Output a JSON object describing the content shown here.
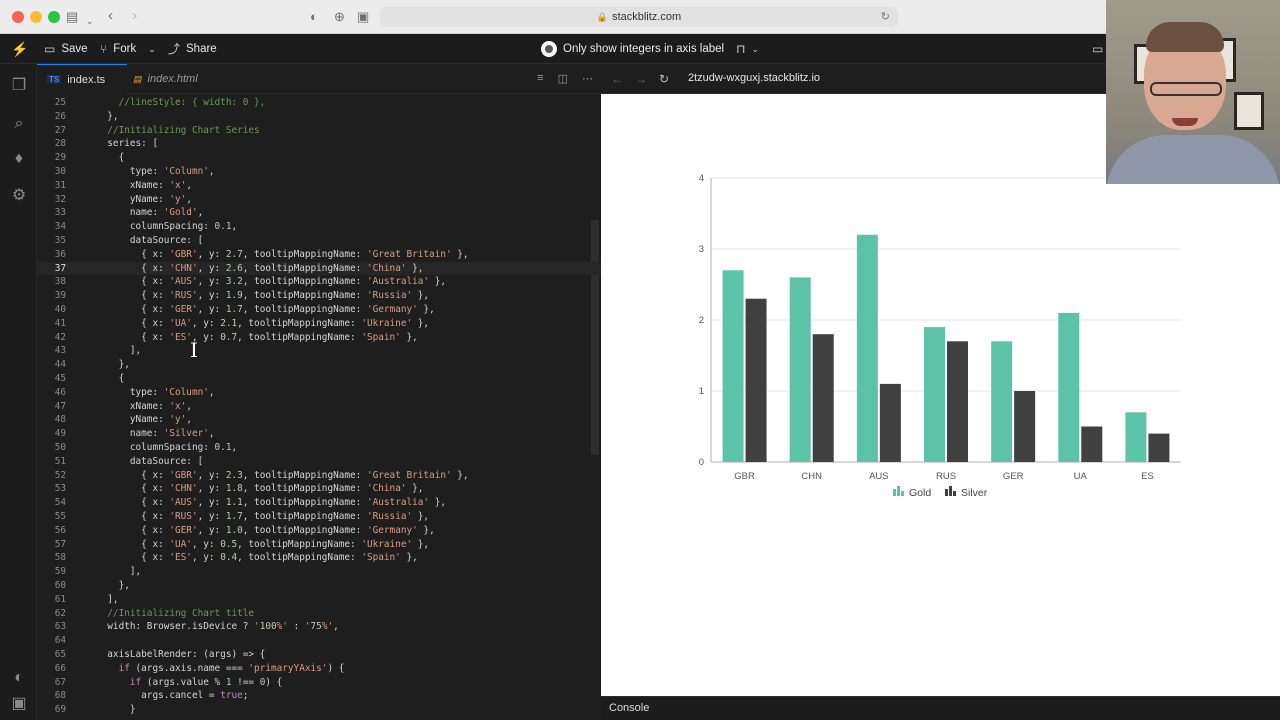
{
  "browser": {
    "url": "stackblitz.com"
  },
  "stackblitz": {
    "save_label": "Save",
    "fork_label": "Fork",
    "share_label": "Share",
    "project_title": "Only show integers in axis label"
  },
  "tabs": [
    {
      "label": "index.ts",
      "badge": "TS"
    },
    {
      "label": "index.html"
    }
  ],
  "preview": {
    "url": "2tzudw-wxguxj.stackblitz.io"
  },
  "console_label": "Console",
  "code_lines": [
    {
      "n": "25",
      "t": "    //lineStyle: { width: 0 },"
    },
    {
      "n": "26",
      "t": "  },"
    },
    {
      "n": "27",
      "t": "  //Initializing Chart Series"
    },
    {
      "n": "28",
      "t": "  series: ["
    },
    {
      "n": "29",
      "t": "    {"
    },
    {
      "n": "30",
      "t": "      type: 'Column',"
    },
    {
      "n": "31",
      "t": "      xName: 'x',"
    },
    {
      "n": "32",
      "t": "      yName: 'y',"
    },
    {
      "n": "33",
      "t": "      name: 'Gold',"
    },
    {
      "n": "34",
      "t": "      columnSpacing: 0.1,"
    },
    {
      "n": "35",
      "t": "      dataSource: ["
    },
    {
      "n": "36",
      "t": "        { x: 'GBR', y: 2.7, tooltipMappingName: 'Great Britain' },"
    },
    {
      "n": "37",
      "t": "        { x: 'CHN', y: 2.6, tooltipMappingName: 'China' },"
    },
    {
      "n": "38",
      "t": "        { x: 'AUS', y: 3.2, tooltipMappingName: 'Australia' },"
    },
    {
      "n": "39",
      "t": "        { x: 'RUS', y: 1.9, tooltipMappingName: 'Russia' },"
    },
    {
      "n": "40",
      "t": "        { x: 'GER', y: 1.7, tooltipMappingName: 'Germany' },"
    },
    {
      "n": "41",
      "t": "        { x: 'UA', y: 2.1, tooltipMappingName: 'Ukraine' },"
    },
    {
      "n": "42",
      "t": "        { x: 'ES', y: 0.7, tooltipMappingName: 'Spain' },"
    },
    {
      "n": "43",
      "t": "      ],"
    },
    {
      "n": "44",
      "t": "    },"
    },
    {
      "n": "45",
      "t": "    {"
    },
    {
      "n": "46",
      "t": "      type: 'Column',"
    },
    {
      "n": "47",
      "t": "      xName: 'x',"
    },
    {
      "n": "48",
      "t": "      yName: 'y',"
    },
    {
      "n": "49",
      "t": "      name: 'Silver',"
    },
    {
      "n": "50",
      "t": "      columnSpacing: 0.1,"
    },
    {
      "n": "51",
      "t": "      dataSource: ["
    },
    {
      "n": "52",
      "t": "        { x: 'GBR', y: 2.3, tooltipMappingName: 'Great Britain' },"
    },
    {
      "n": "53",
      "t": "        { x: 'CHN', y: 1.8, tooltipMappingName: 'China' },"
    },
    {
      "n": "54",
      "t": "        { x: 'AUS', y: 1.1, tooltipMappingName: 'Australia' },"
    },
    {
      "n": "55",
      "t": "        { x: 'RUS', y: 1.7, tooltipMappingName: 'Russia' },"
    },
    {
      "n": "56",
      "t": "        { x: 'GER', y: 1.0, tooltipMappingName: 'Germany' },"
    },
    {
      "n": "57",
      "t": "        { x: 'UA', y: 0.5, tooltipMappingName: 'Ukraine' },"
    },
    {
      "n": "58",
      "t": "        { x: 'ES', y: 0.4, tooltipMappingName: 'Spain' },"
    },
    {
      "n": "59",
      "t": "      ],"
    },
    {
      "n": "60",
      "t": "    },"
    },
    {
      "n": "61",
      "t": "  ],"
    },
    {
      "n": "62",
      "t": "  //Initializing Chart title"
    },
    {
      "n": "63",
      "t": "  width: Browser.isDevice ? '100%' : '75%',"
    },
    {
      "n": "64",
      "t": ""
    },
    {
      "n": "65",
      "t": "  axisLabelRender: (args) => {"
    },
    {
      "n": "66",
      "t": "    if (args.axis.name === 'primaryYAxis') {"
    },
    {
      "n": "67",
      "t": "      if (args.value % 1 !== 0) {"
    },
    {
      "n": "68",
      "t": "        args.cancel = true;"
    },
    {
      "n": "69",
      "t": "      }"
    }
  ],
  "chart_data": {
    "type": "bar",
    "categories": [
      "GBR",
      "CHN",
      "AUS",
      "RUS",
      "GER",
      "UA",
      "ES"
    ],
    "series": [
      {
        "name": "Gold",
        "values": [
          2.7,
          2.6,
          3.2,
          1.9,
          1.7,
          2.1,
          0.7
        ],
        "color": "#5cc3a8"
      },
      {
        "name": "Silver",
        "values": [
          2.3,
          1.8,
          1.1,
          1.7,
          1.0,
          0.5,
          0.4
        ],
        "color": "#404040"
      }
    ],
    "y_ticks": [
      "0",
      "1",
      "2",
      "3",
      "4"
    ],
    "ylim": [
      0,
      4
    ],
    "grid": true,
    "legend_position": "bottom"
  }
}
